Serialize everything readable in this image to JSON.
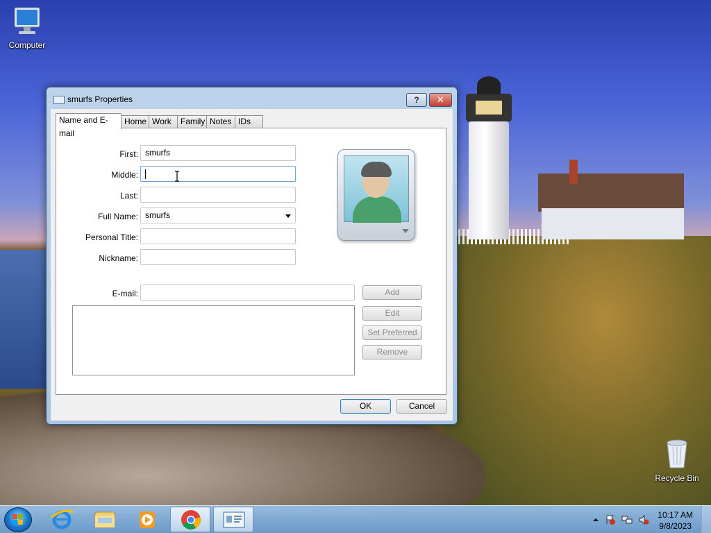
{
  "desktop": {
    "icons": [
      {
        "label": "Computer",
        "icon": "computer-icon"
      },
      {
        "label": "Recycle Bin",
        "icon": "recycle-bin-icon"
      }
    ]
  },
  "dialog": {
    "title": "smurfs Properties",
    "help_label": "?",
    "close_label": "✕",
    "tabs": [
      {
        "label": "Name and E-mail",
        "active": true
      },
      {
        "label": "Home",
        "active": false
      },
      {
        "label": "Work",
        "active": false
      },
      {
        "label": "Family",
        "active": false
      },
      {
        "label": "Notes",
        "active": false
      },
      {
        "label": "IDs",
        "active": false
      }
    ],
    "fields": {
      "first": {
        "label": "First:",
        "value": "smurfs"
      },
      "middle": {
        "label": "Middle:",
        "value": ""
      },
      "last": {
        "label": "Last:",
        "value": ""
      },
      "full_name": {
        "label": "Full Name:",
        "value": "smurfs"
      },
      "personal_title": {
        "label": "Personal Title:",
        "value": ""
      },
      "nickname": {
        "label": "Nickname:",
        "value": ""
      },
      "email": {
        "label": "E-mail:",
        "value": ""
      }
    },
    "email_buttons": {
      "add": "Add",
      "edit": "Edit",
      "set_preferred": "Set Preferred",
      "remove": "Remove"
    },
    "ok_label": "OK",
    "cancel_label": "Cancel"
  },
  "taskbar": {
    "items": [
      "start-orb-icon",
      "internet-explorer-icon",
      "file-explorer-icon",
      "media-player-icon",
      "chrome-icon",
      "contacts-icon"
    ],
    "active_item": "contacts-icon",
    "clock": {
      "time": "10:17 AM",
      "date": "9/8/2023"
    },
    "tray_icons": [
      "show-hidden-icons-icon",
      "action-center-icon",
      "network-icon",
      "volume-muted-icon"
    ]
  }
}
